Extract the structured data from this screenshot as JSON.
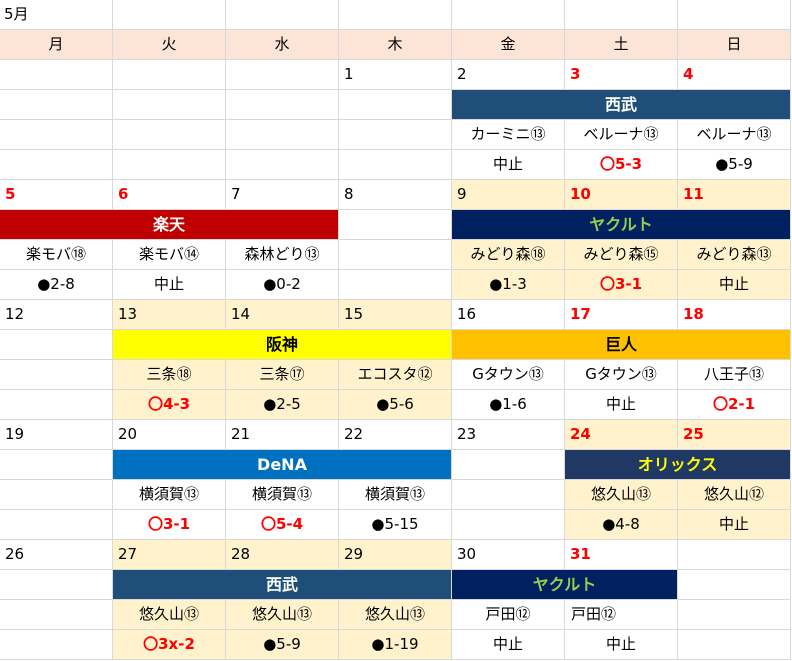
{
  "month_label": "5月",
  "weekdays": [
    "月",
    "火",
    "水",
    "木",
    "金",
    "土",
    "日"
  ],
  "colors": {
    "grid_line": "#D9D9D9",
    "header_bg": "#FCE4D6",
    "home_bg": "#FFF2CC",
    "red_text": "#FF0000"
  },
  "weeks": [
    {
      "days": [
        {},
        {},
        {},
        {
          "date": "1"
        },
        {
          "date": "2",
          "venue": "カーミニ⑬",
          "result": "中止"
        },
        {
          "date": "3",
          "red": true,
          "venue": "ベルーナ⑬",
          "result": "〇5-3"
        },
        {
          "date": "4",
          "red": true,
          "venue": "ベルーナ⑬",
          "result": "●5-9"
        }
      ],
      "series": [
        {
          "team": "西武",
          "dates": [
            "2",
            "3",
            "4"
          ],
          "bg": "#1F4E78",
          "fg": "#FFFFFF"
        }
      ]
    },
    {
      "days": [
        {
          "date": "5",
          "red": true,
          "venue": "楽モバ⑱",
          "result": "●2-8"
        },
        {
          "date": "6",
          "red": true,
          "venue": "楽モバ⑭",
          "result": "中止"
        },
        {
          "date": "7",
          "venue": "森林どり⑬",
          "result": "●0-2"
        },
        {
          "date": "8"
        },
        {
          "date": "9",
          "home": true,
          "venue": "みどり森⑱",
          "result": "●1-3"
        },
        {
          "date": "10",
          "red": true,
          "home": true,
          "venue": "みどり森⑮",
          "result": "〇3-1"
        },
        {
          "date": "11",
          "red": true,
          "home": true,
          "venue": "みどり森⑬",
          "result": "中止"
        }
      ],
      "series": [
        {
          "team": "楽天",
          "dates": [
            "5",
            "6",
            "7"
          ],
          "bg": "#C00000",
          "fg": "#FFFFFF"
        },
        {
          "team": "ヤクルト",
          "dates": [
            "9",
            "10",
            "11"
          ],
          "bg": "#002060",
          "fg": "#92D050"
        }
      ]
    },
    {
      "days": [
        {
          "date": "12"
        },
        {
          "date": "13",
          "home": true,
          "venue": "三条⑱",
          "result": "〇4-3"
        },
        {
          "date": "14",
          "home": true,
          "venue": "三条⑰",
          "result": "●2-5"
        },
        {
          "date": "15",
          "home": true,
          "venue": "エコスタ⑫",
          "result": "●5-6"
        },
        {
          "date": "16",
          "venue": "Gタウン⑬",
          "result": "●1-6"
        },
        {
          "date": "17",
          "red": true,
          "venue": "Gタウン⑬",
          "result": "中止"
        },
        {
          "date": "18",
          "red": true,
          "venue": "八王子⑬",
          "result": "〇2-1"
        }
      ],
      "series": [
        {
          "team": "阪神",
          "dates": [
            "13",
            "14",
            "15"
          ],
          "bg": "#FFFF00",
          "fg": "#000000"
        },
        {
          "team": "巨人",
          "dates": [
            "16",
            "17",
            "18"
          ],
          "bg": "#FFC000",
          "fg": "#000000"
        }
      ]
    },
    {
      "days": [
        {
          "date": "19"
        },
        {
          "date": "20",
          "venue": "横須賀⑬",
          "result": "〇3-1"
        },
        {
          "date": "21",
          "venue": "横須賀⑬",
          "result": "〇5-4"
        },
        {
          "date": "22",
          "venue": "横須賀⑬",
          "result": "●5-15"
        },
        {
          "date": "23"
        },
        {
          "date": "24",
          "red": true,
          "home": true,
          "venue": "悠久山⑬",
          "result": "●4-8"
        },
        {
          "date": "25",
          "red": true,
          "home": true,
          "venue": "悠久山⑫",
          "result": "中止"
        }
      ],
      "series": [
        {
          "team": "DeNA",
          "dates": [
            "20",
            "21",
            "22"
          ],
          "bg": "#0070C0",
          "fg": "#FFFFFF"
        },
        {
          "team": "オリックス",
          "dates": [
            "24",
            "25"
          ],
          "bg": "#1F3864",
          "fg": "#FFFF00"
        }
      ]
    },
    {
      "days": [
        {
          "date": "26"
        },
        {
          "date": "27",
          "home": true,
          "venue": "悠久山⑬",
          "result": "〇3x-2"
        },
        {
          "date": "28",
          "home": true,
          "venue": "悠久山⑬",
          "result": "●5-9"
        },
        {
          "date": "29",
          "home": true,
          "venue": "悠久山⑬",
          "result": "●1-19"
        },
        {
          "date": "30",
          "venue": "戸田⑫",
          "result": "中止"
        },
        {
          "date": "31",
          "red": true,
          "venue": "戸田⑫",
          "result": "中止"
        },
        {}
      ],
      "series": [
        {
          "team": "西武",
          "dates": [
            "27",
            "28",
            "29"
          ],
          "bg": "#1F4E78",
          "fg": "#FFFFFF"
        },
        {
          "team": "ヤクルト",
          "dates": [
            "30",
            "31"
          ],
          "bg": "#002060",
          "fg": "#92D050"
        }
      ]
    }
  ]
}
